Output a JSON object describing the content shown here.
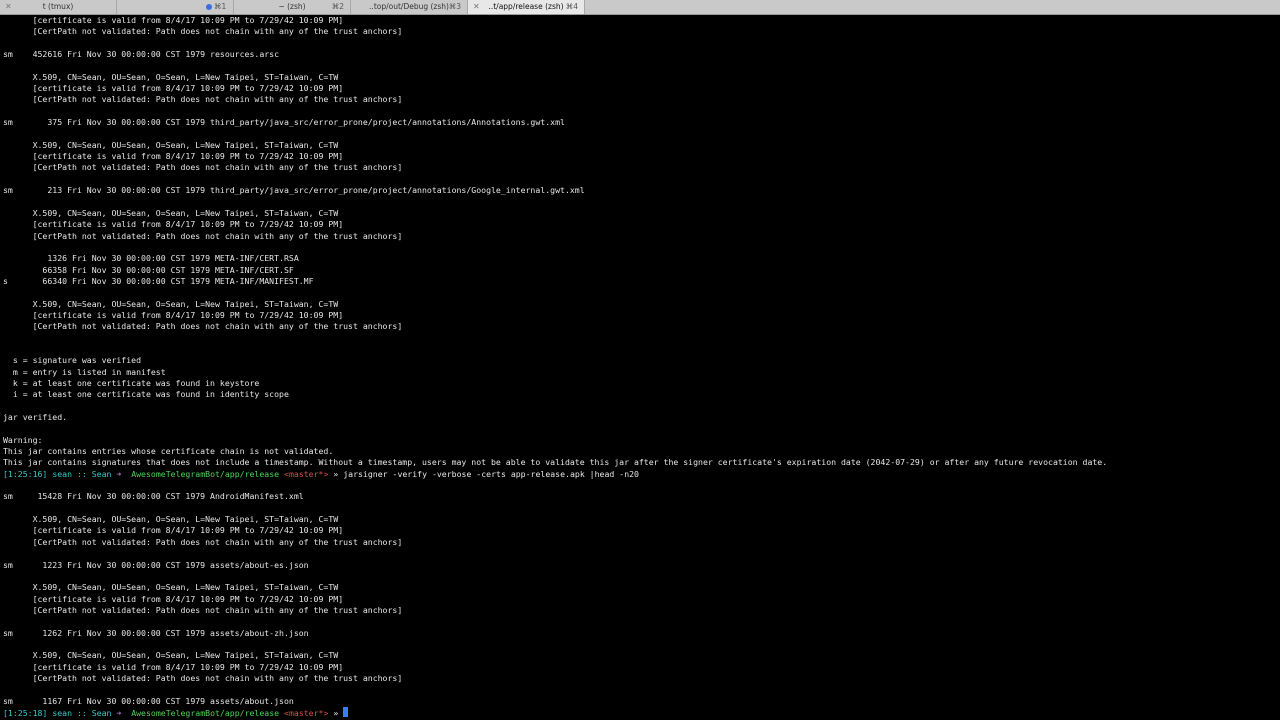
{
  "tabs": [
    {
      "title": "t (tmux)",
      "shortcut": "",
      "active": false,
      "unread": false
    },
    {
      "title": "⌘1",
      "shortcut": "",
      "active": false,
      "unread": true
    },
    {
      "title": "~ (zsh)",
      "shortcut": "⌘2",
      "active": false,
      "unread": false
    },
    {
      "title": "..top/out/Debug (zsh)",
      "shortcut": "⌘3",
      "active": false,
      "unread": false
    },
    {
      "title": "..t/app/release (zsh)",
      "shortcut": "⌘4",
      "active": true,
      "unread": false
    }
  ],
  "close_glyph": "✕",
  "lines": [
    "      [certificate is valid from 8/4/17 10:09 PM to 7/29/42 10:09 PM]",
    "      [CertPath not validated: Path does not chain with any of the trust anchors]",
    "",
    "sm    452616 Fri Nov 30 00:00:00 CST 1979 resources.arsc",
    "",
    "      X.509, CN=Sean, OU=Sean, O=Sean, L=New Taipei, ST=Taiwan, C=TW",
    "      [certificate is valid from 8/4/17 10:09 PM to 7/29/42 10:09 PM]",
    "      [CertPath not validated: Path does not chain with any of the trust anchors]",
    "",
    "sm       375 Fri Nov 30 00:00:00 CST 1979 third_party/java_src/error_prone/project/annotations/Annotations.gwt.xml",
    "",
    "      X.509, CN=Sean, OU=Sean, O=Sean, L=New Taipei, ST=Taiwan, C=TW",
    "      [certificate is valid from 8/4/17 10:09 PM to 7/29/42 10:09 PM]",
    "      [CertPath not validated: Path does not chain with any of the trust anchors]",
    "",
    "sm       213 Fri Nov 30 00:00:00 CST 1979 third_party/java_src/error_prone/project/annotations/Google_internal.gwt.xml",
    "",
    "      X.509, CN=Sean, OU=Sean, O=Sean, L=New Taipei, ST=Taiwan, C=TW",
    "      [certificate is valid from 8/4/17 10:09 PM to 7/29/42 10:09 PM]",
    "      [CertPath not validated: Path does not chain with any of the trust anchors]",
    "",
    "         1326 Fri Nov 30 00:00:00 CST 1979 META-INF/CERT.RSA",
    "        66358 Fri Nov 30 00:00:00 CST 1979 META-INF/CERT.SF",
    "s       66340 Fri Nov 30 00:00:00 CST 1979 META-INF/MANIFEST.MF",
    "",
    "      X.509, CN=Sean, OU=Sean, O=Sean, L=New Taipei, ST=Taiwan, C=TW",
    "      [certificate is valid from 8/4/17 10:09 PM to 7/29/42 10:09 PM]",
    "      [CertPath not validated: Path does not chain with any of the trust anchors]",
    "",
    "",
    "  s = signature was verified",
    "  m = entry is listed in manifest",
    "  k = at least one certificate was found in keystore",
    "  i = at least one certificate was found in identity scope",
    "",
    "jar verified.",
    "",
    "Warning:",
    "This jar contains entries whose certificate chain is not validated.",
    "This jar contains signatures that does not include a timestamp. Without a timestamp, users may not be able to validate this jar after the signer certificate's expiration date (2042-07-29) or after any future revocation date."
  ],
  "prompt1": {
    "time": "[1:25:16]",
    "user": "sean :: Sean",
    "arrow": "➜",
    "path": "AwesomeTelegramBot/app/release",
    "branch": "<master*>",
    "symbol": "»",
    "command": "jarsigner -verify -verbose -certs app-release.apk |head -n20"
  },
  "lines2": [
    "",
    "sm     15428 Fri Nov 30 00:00:00 CST 1979 AndroidManifest.xml",
    "",
    "      X.509, CN=Sean, OU=Sean, O=Sean, L=New Taipei, ST=Taiwan, C=TW",
    "      [certificate is valid from 8/4/17 10:09 PM to 7/29/42 10:09 PM]",
    "      [CertPath not validated: Path does not chain with any of the trust anchors]",
    "",
    "sm      1223 Fri Nov 30 00:00:00 CST 1979 assets/about-es.json",
    "",
    "      X.509, CN=Sean, OU=Sean, O=Sean, L=New Taipei, ST=Taiwan, C=TW",
    "      [certificate is valid from 8/4/17 10:09 PM to 7/29/42 10:09 PM]",
    "      [CertPath not validated: Path does not chain with any of the trust anchors]",
    "",
    "sm      1262 Fri Nov 30 00:00:00 CST 1979 assets/about-zh.json",
    "",
    "      X.509, CN=Sean, OU=Sean, O=Sean, L=New Taipei, ST=Taiwan, C=TW",
    "      [certificate is valid from 8/4/17 10:09 PM to 7/29/42 10:09 PM]",
    "      [CertPath not validated: Path does not chain with any of the trust anchors]",
    "",
    "sm      1167 Fri Nov 30 00:00:00 CST 1979 assets/about.json"
  ],
  "prompt2": {
    "time": "[1:25:18]",
    "user": "sean :: Sean",
    "arrow": "➜",
    "path": "AwesomeTelegramBot/app/release",
    "branch": "<master*>",
    "symbol": "»"
  },
  "colors": {
    "background": "#000000",
    "text": "#e6e6e6",
    "time": "#38c9c9",
    "arrow": "#b96ad9",
    "path": "#4fd15a",
    "branch": "#d14f4f",
    "cursor": "#3b7cff"
  }
}
